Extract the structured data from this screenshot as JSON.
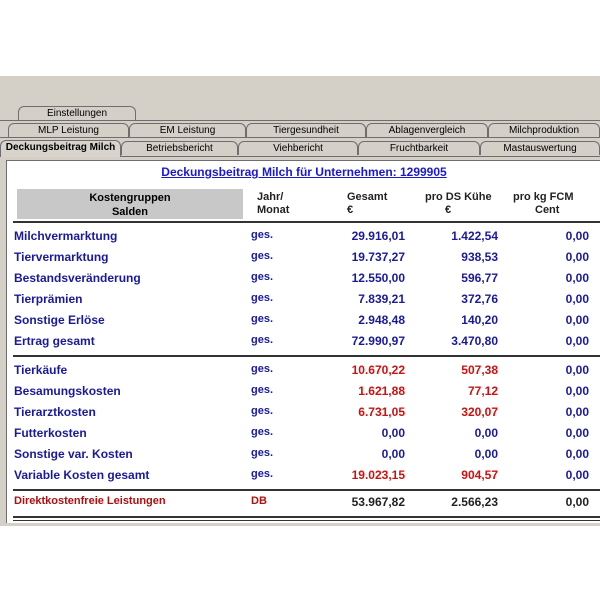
{
  "tabs_row1": [
    "Einstellungen"
  ],
  "tabs_row2": [
    "MLP Leistung",
    "EM Leistung",
    "Tiergesundheit",
    "Ablagenvergleich",
    "Milchproduktion"
  ],
  "tabs_row3": [
    "Deckungsbeitrag Milch",
    "Betriebsbericht",
    "Viehbericht",
    "Fruchtbarkeit",
    "Mastauswertung"
  ],
  "title": "Deckungsbeitrag Milch für Unternehmen: 1299905",
  "headers": {
    "kostengruppen": "Kostengruppen",
    "salden": "Salden",
    "jahr": "Jahr/",
    "monat": "Monat",
    "gesamt": "Gesamt",
    "gesamt_unit": "€",
    "pro_ds": "pro DS Kühe",
    "pro_ds_unit": "€",
    "pro_kg": "pro kg FCM",
    "pro_kg_unit": "Cent"
  },
  "rows": [
    {
      "label": "Milchvermarktung",
      "period": "ges.",
      "gesamt": "29.916,01",
      "pro_ds": "1.422,54",
      "pro_kg": "0,00",
      "color": "blue"
    },
    {
      "label": "Tiervermarktung",
      "period": "ges.",
      "gesamt": "19.737,27",
      "pro_ds": "938,53",
      "pro_kg": "0,00",
      "color": "blue"
    },
    {
      "label": "Bestandsveränderung",
      "period": "ges.",
      "gesamt": "12.550,00",
      "pro_ds": "596,77",
      "pro_kg": "0,00",
      "color": "blue"
    },
    {
      "label": "Tierprämien",
      "period": "ges.",
      "gesamt": "7.839,21",
      "pro_ds": "372,76",
      "pro_kg": "0,00",
      "color": "blue"
    },
    {
      "label": "Sonstige Erlöse",
      "period": "ges.",
      "gesamt": "2.948,48",
      "pro_ds": "140,20",
      "pro_kg": "0,00",
      "color": "blue"
    },
    {
      "label": "Ertrag gesamt",
      "period": "ges.",
      "gesamt": "72.990,97",
      "pro_ds": "3.470,80",
      "pro_kg": "0,00",
      "color": "blue"
    },
    {
      "label": "Tierkäufe",
      "period": "ges.",
      "gesamt": "10.670,22",
      "pro_ds": "507,38",
      "pro_kg": "0,00",
      "color": "red"
    },
    {
      "label": "Besamungskosten",
      "period": "ges.",
      "gesamt": "1.621,88",
      "pro_ds": "77,12",
      "pro_kg": "0,00",
      "color": "red"
    },
    {
      "label": "Tierarztkosten",
      "period": "ges.",
      "gesamt": "6.731,05",
      "pro_ds": "320,07",
      "pro_kg": "0,00",
      "color": "red"
    },
    {
      "label": "Futterkosten",
      "period": "ges.",
      "gesamt": "0,00",
      "pro_ds": "0,00",
      "pro_kg": "0,00",
      "color": "blue"
    },
    {
      "label": "Sonstige var. Kosten",
      "period": "ges.",
      "gesamt": "0,00",
      "pro_ds": "0,00",
      "pro_kg": "0,00",
      "color": "blue"
    },
    {
      "label": "Variable Kosten gesamt",
      "period": "ges.",
      "gesamt": "19.023,15",
      "pro_ds": "904,57",
      "pro_kg": "0,00",
      "color": "red"
    },
    {
      "label": "Direktkostenfreie Leistungen",
      "period": "DB",
      "gesamt": "53.967,82",
      "pro_ds": "2.566,23",
      "pro_kg": "0,00",
      "color": "dark"
    }
  ]
}
